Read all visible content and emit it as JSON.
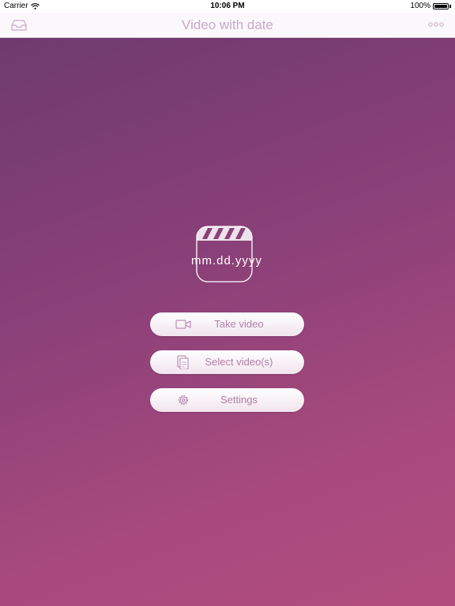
{
  "status_bar": {
    "carrier": "Carrier",
    "time": "10:06 PM",
    "battery": "100%",
    "battery_level": 1.0
  },
  "nav": {
    "title": "Video with date",
    "left_icon": "inbox-icon",
    "right_icon": "more-icon"
  },
  "logo": {
    "date_format": "mm.dd.yyyy",
    "icon": "clapperboard-icon"
  },
  "buttons": {
    "take_video": "Take video",
    "select_videos": "Select video(s)",
    "settings": "Settings"
  },
  "colors": {
    "accent": "#b07ea8",
    "title": "#c8a9c8",
    "gradient_start": "#6e3b6e",
    "gradient_end": "#b14c7e"
  }
}
